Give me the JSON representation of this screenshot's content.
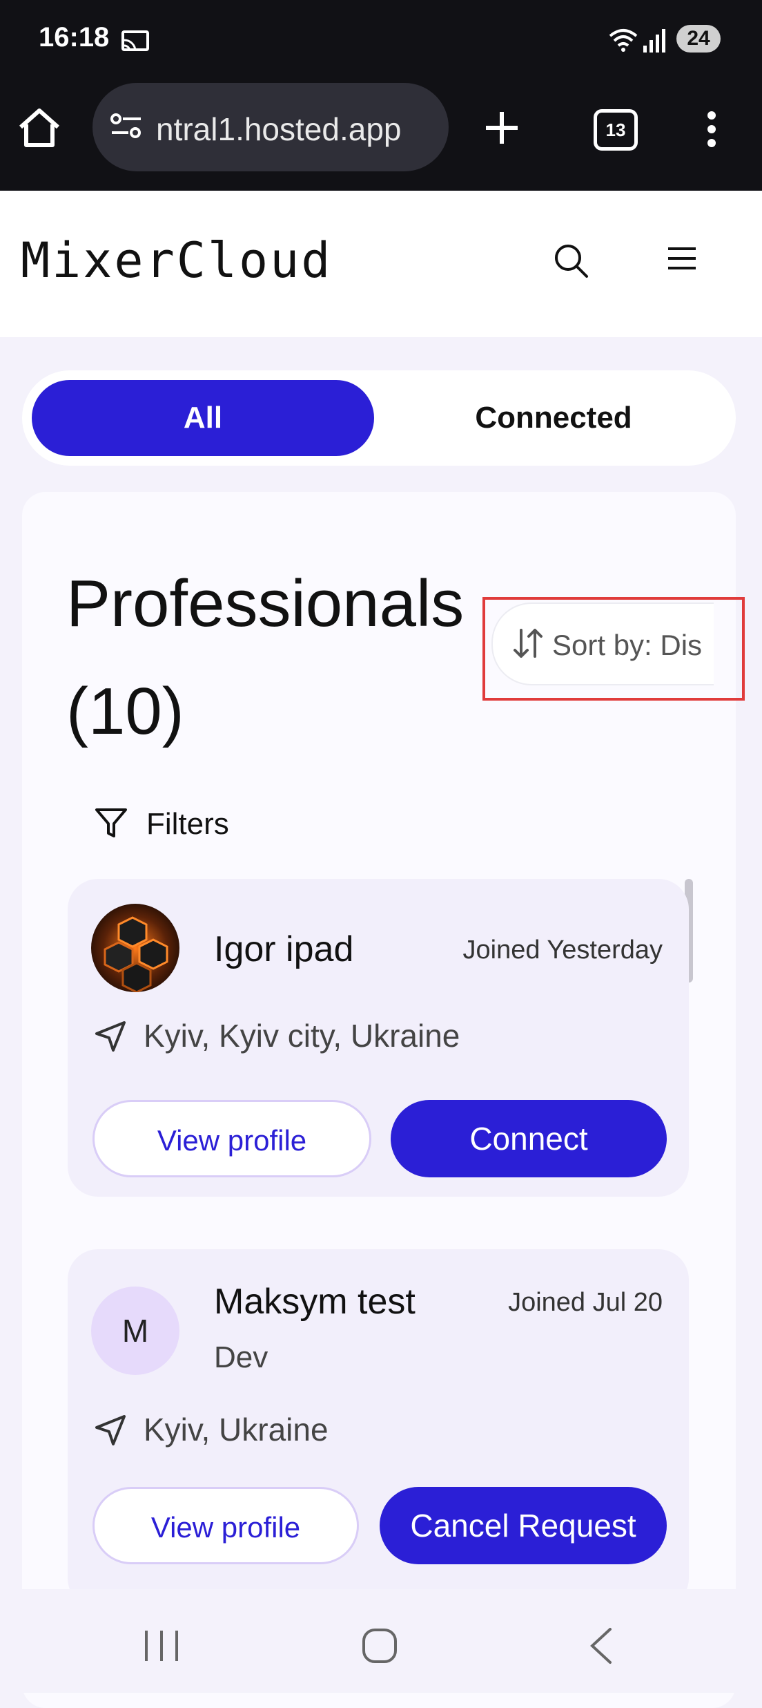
{
  "status_bar": {
    "time": "16:18",
    "battery": "24"
  },
  "browser": {
    "url": "ntral1.hosted.app",
    "tab_count": "13"
  },
  "app": {
    "logo": "MixerCloud"
  },
  "tabs": [
    {
      "label": "All",
      "active": true
    },
    {
      "label": "Connected",
      "active": false
    }
  ],
  "main": {
    "title": "Professionals (10)",
    "sort_label": "Sort by: Dis",
    "filters_label": "Filters"
  },
  "users": [
    {
      "name": "Igor ipad",
      "joined": "Joined Yesterday",
      "role": "",
      "location": "Kyiv, Kyiv city, Ukraine",
      "secondary_button": "View profile",
      "primary_button": "Connect"
    },
    {
      "name": "Maksym test",
      "initial": "M",
      "joined": "Joined Jul 20",
      "role": "Dev",
      "location": "Kyiv, Ukraine",
      "secondary_button": "View profile",
      "primary_button": "Cancel Request"
    }
  ],
  "colors": {
    "accent": "#2b1fd6",
    "background": "#f4f2fb",
    "highlight": "#e03b3b"
  }
}
